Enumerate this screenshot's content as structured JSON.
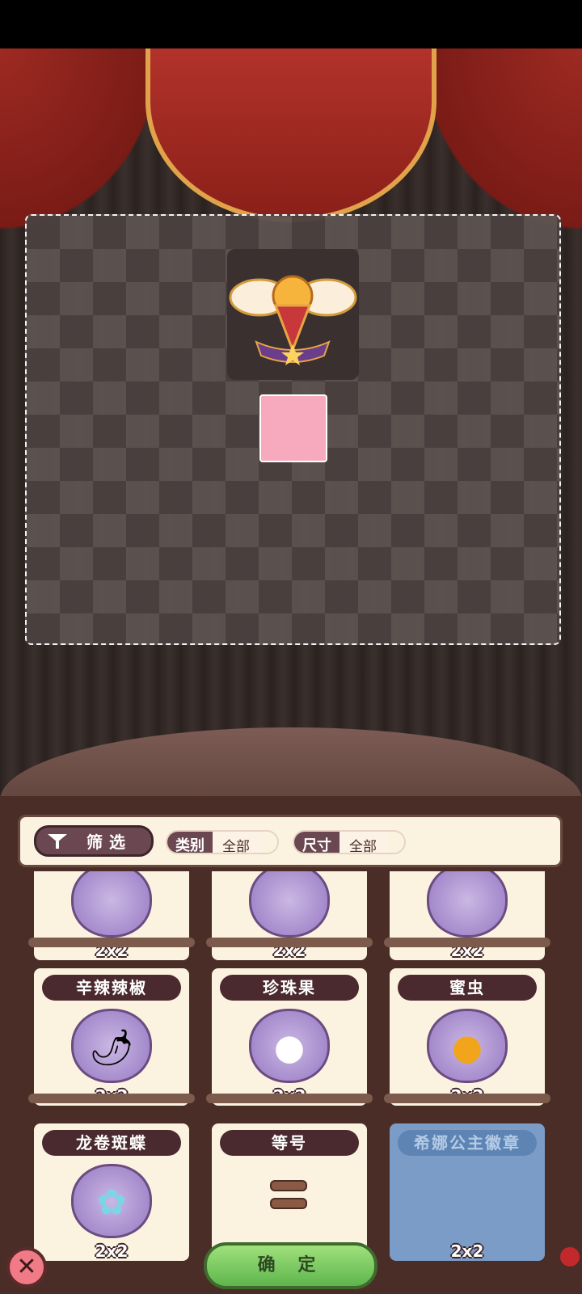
{
  "filter": {
    "button_label": "筛选",
    "category_key": "类别",
    "category_value": "全部",
    "size_key": "尺寸",
    "size_value": "全部"
  },
  "top_row": [
    {
      "size": "2x2"
    },
    {
      "size": "2x2"
    },
    {
      "size": "2x2"
    }
  ],
  "items": [
    {
      "name": "辛辣辣椒",
      "size": "2x2",
      "icon": "chili-pepper-icon"
    },
    {
      "name": "珍珠果",
      "size": "2x2",
      "icon": "pearl-fruit-icon"
    },
    {
      "name": "蜜虫",
      "size": "2x2",
      "icon": "honey-bug-icon"
    },
    {
      "name": "龙卷斑蝶",
      "size": "2x2",
      "icon": "butterfly-icon"
    },
    {
      "name": "等号",
      "size": "",
      "icon": "equals-sign-icon"
    },
    {
      "name": "希娜公主徽章",
      "size": "2x2",
      "icon": "princess-badge-icon"
    }
  ],
  "confirm_label": "确 定",
  "close_icon": "close-icon"
}
